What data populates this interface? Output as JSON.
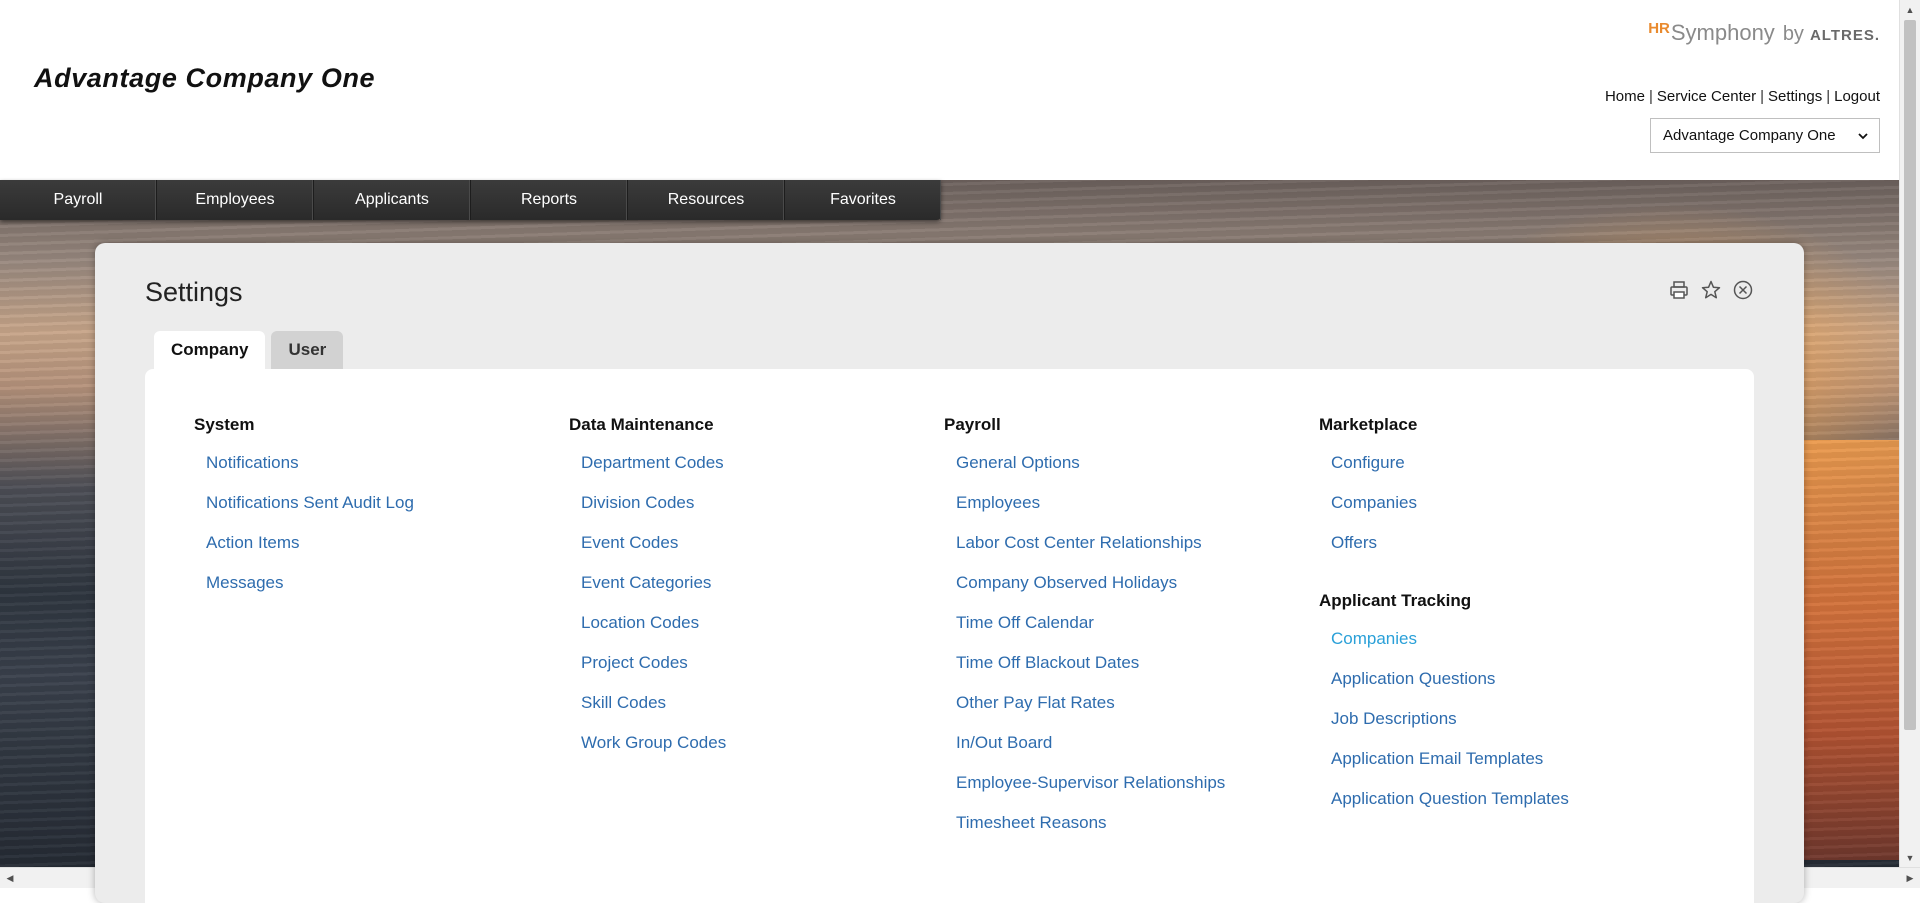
{
  "header": {
    "company_title": "Advantage Company One",
    "brand": {
      "hr": "HR",
      "symphony": "Symphony",
      "by": "by",
      "altres": "ALTRES."
    },
    "links": [
      "Home",
      "Service Center",
      "Settings",
      "Logout"
    ],
    "separator": "|",
    "company_select": {
      "value": "Advantage Company One"
    }
  },
  "nav": {
    "items": [
      "Payroll",
      "Employees",
      "Applicants",
      "Reports",
      "Resources",
      "Favorites"
    ]
  },
  "panel": {
    "title": "Settings",
    "icons": [
      "print-icon",
      "star-icon",
      "close-circle-icon"
    ],
    "tabs": [
      {
        "label": "Company",
        "active": true
      },
      {
        "label": "User",
        "active": false
      }
    ],
    "columns": [
      {
        "heading": "System",
        "links": [
          "Notifications",
          "Notifications Sent Audit Log",
          "Action Items",
          "Messages"
        ]
      },
      {
        "heading": "Data Maintenance",
        "links": [
          "Department Codes",
          "Division Codes",
          "Event Codes",
          "Event Categories",
          "Location Codes",
          "Project Codes",
          "Skill Codes",
          "Work Group Codes"
        ]
      },
      {
        "heading": "Payroll",
        "links": [
          "General Options",
          "Employees",
          "Labor Cost Center Relationships",
          "Company Observed Holidays",
          "Time Off Calendar",
          "Time Off Blackout Dates",
          "Other Pay Flat Rates",
          "In/Out Board",
          "Employee-Supervisor Relationships",
          "Timesheet Reasons"
        ]
      },
      {
        "heading": "Marketplace",
        "links": [
          "Configure",
          "Companies",
          "Offers"
        ],
        "sub_heading": "Applicant Tracking",
        "sub_links": [
          "Companies",
          "Application Questions",
          "Job Descriptions",
          "Application Email Templates",
          "Application Question Templates"
        ]
      }
    ]
  },
  "colors": {
    "link": "#2e6cae",
    "link_highlight": "#2aa0d8",
    "brand_hr": "#e98a2e",
    "nav_bg": "#2f2f2f"
  }
}
